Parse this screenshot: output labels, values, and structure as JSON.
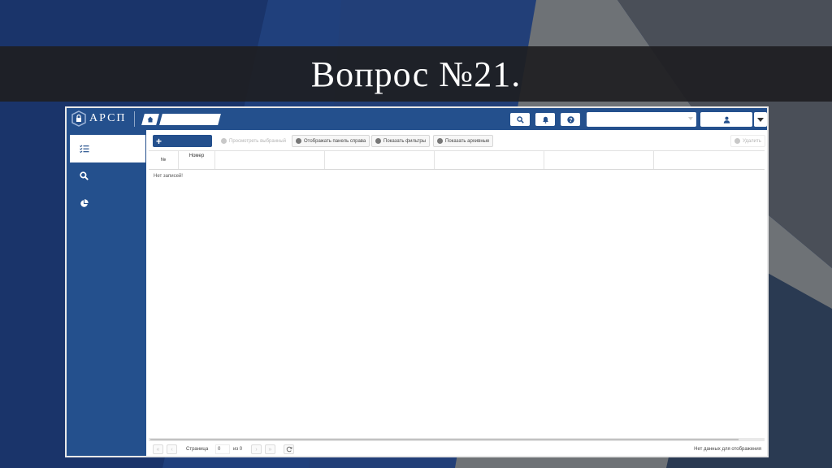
{
  "slide": {
    "title": "Вопрос №21."
  },
  "app": {
    "logo_text": "АРСП",
    "icons": {
      "logo": "shield-lock-icon",
      "home": "home-icon",
      "search": "search-icon",
      "notifications": "bell-icon",
      "help": "question-icon",
      "user": "user-icon",
      "sidebar": [
        "list-check-icon",
        "search-icon",
        "pie-chart-icon"
      ]
    },
    "colors": {
      "primary": "#24508d",
      "background": "#ffffff"
    }
  },
  "toolbar": {
    "add_label": "+",
    "view_selected": "Просмотреть выбранный",
    "show_right_panel": "Отображать панель справа",
    "show_filters": "Показать фильтры",
    "show_archived": "Показать архивные",
    "delete": "Удалить"
  },
  "table": {
    "columns": [
      "№",
      "Номер",
      "",
      "",
      "",
      "",
      ""
    ],
    "empty_message": "Нет записей!"
  },
  "pager": {
    "page_label": "Страница",
    "page_value": "0",
    "of_label": "из 0",
    "no_data": "Нет данных для отображения"
  }
}
